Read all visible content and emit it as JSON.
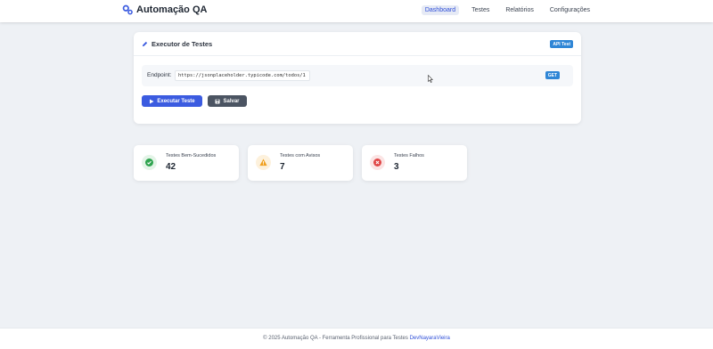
{
  "header": {
    "brand_title": "Automação QA",
    "nav": [
      {
        "label": "Dashboard",
        "active": true
      },
      {
        "label": "Testes",
        "active": false
      },
      {
        "label": "Relatórios",
        "active": false
      },
      {
        "label": "Configurações",
        "active": false
      }
    ]
  },
  "executor": {
    "title": "Executor de Testes",
    "badge": "API Test",
    "endpoint_label": "Endpoint:",
    "endpoint_value": "https://jsonplaceholder.typicode.com/todos/1",
    "method": "GET",
    "run_label": "Executar Teste",
    "save_label": "Salvar"
  },
  "stats": [
    {
      "label": "Testes Bem-Sucedidos",
      "value": "42",
      "icon": "check-circle-icon",
      "color": "#2fa44f"
    },
    {
      "label": "Testes com Avisos",
      "value": "7",
      "icon": "warning-triangle-icon",
      "color": "#f0a020"
    },
    {
      "label": "Testes Falhos",
      "value": "3",
      "icon": "x-circle-icon",
      "color": "#e04848"
    }
  ],
  "footer": {
    "text": "© 2025 Automação QA - Ferramenta Profissional para Testes",
    "link": "DevNayaraVieira"
  },
  "colors": {
    "accent": "#3b5be0",
    "badge_blue": "#2f86d6",
    "page_bg": "#eef1f5"
  }
}
